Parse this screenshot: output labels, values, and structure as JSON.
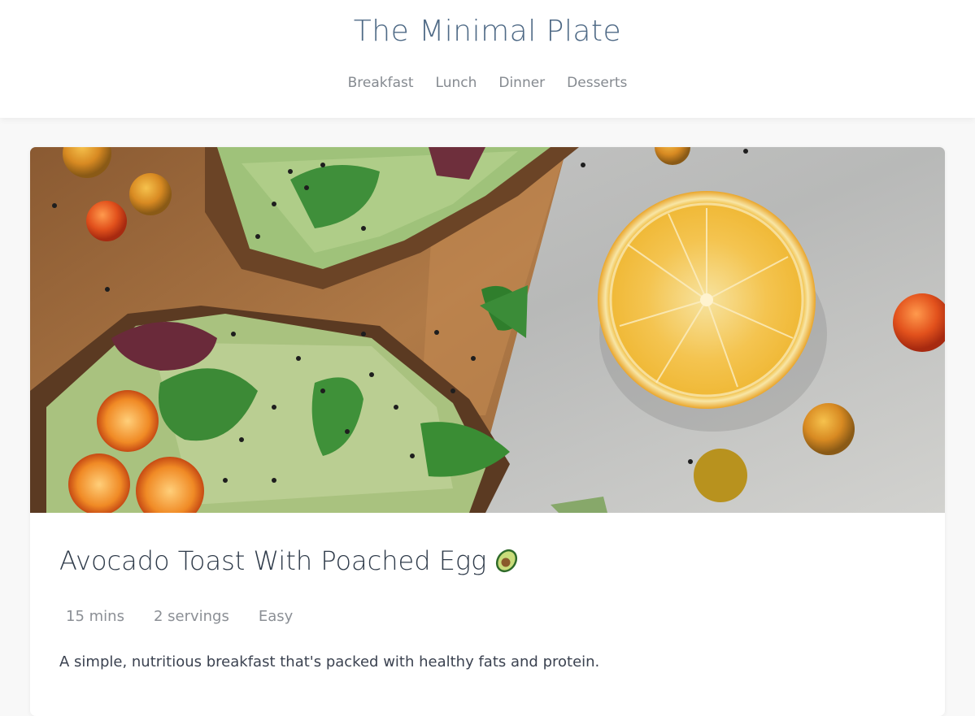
{
  "site": {
    "title": "The Minimal Plate"
  },
  "nav": {
    "items": [
      "Breakfast",
      "Lunch",
      "Dinner",
      "Desserts"
    ]
  },
  "recipe": {
    "image_alt_icon": "avocado-toast-photo",
    "title": "Avocado Toast With Poached Egg",
    "title_icon": "avocado-emoji-icon",
    "meta": {
      "time": "15 mins",
      "servings": "2 servings",
      "difficulty": "Easy"
    },
    "description": "A simple, nutritious breakfast that's packed with healthy fats and protein."
  },
  "colors": {
    "title": "#4f6a86",
    "nav": "#858a90",
    "heading": "#2f3b4a",
    "meta": "#8b8f95"
  }
}
